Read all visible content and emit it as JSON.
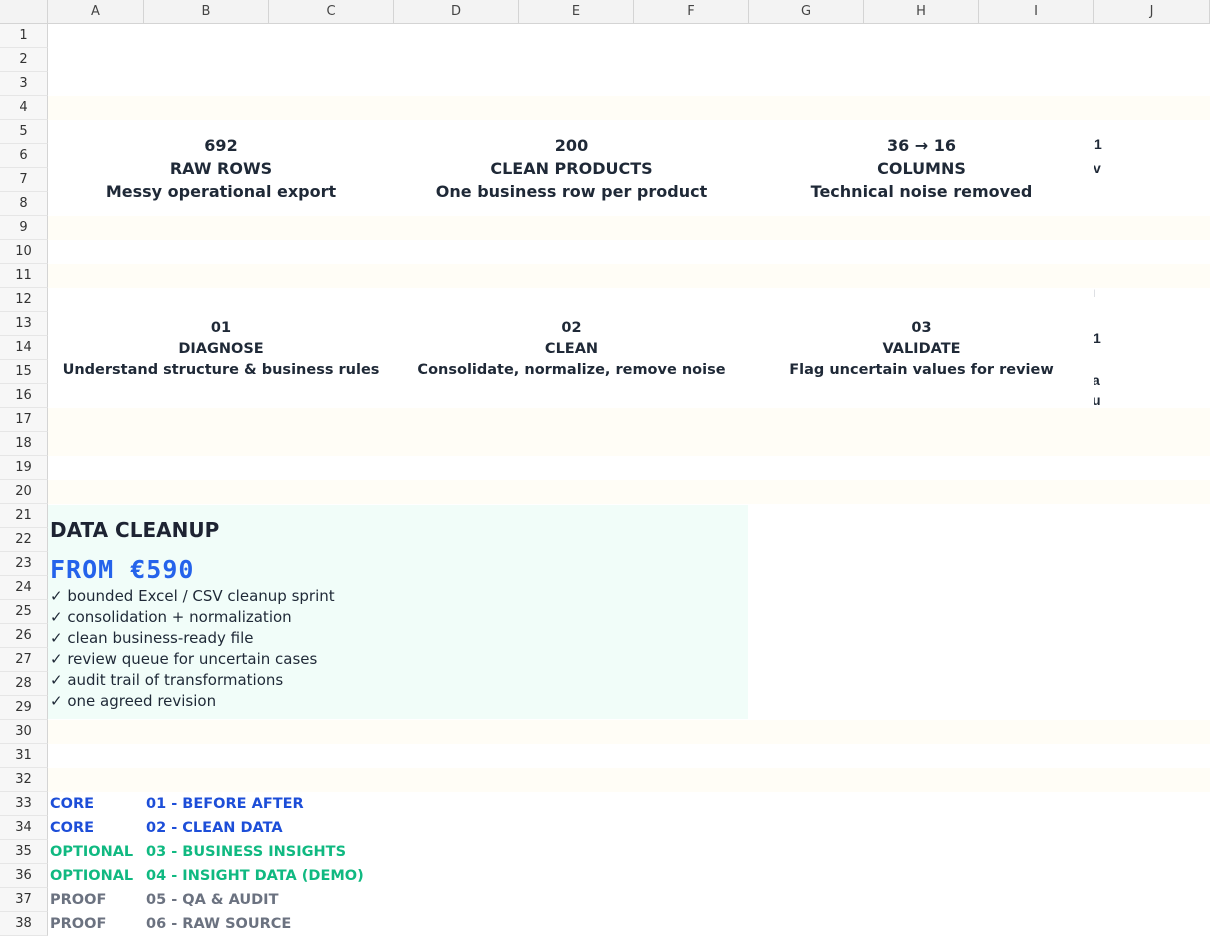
{
  "columns": [
    "A",
    "B",
    "C",
    "D",
    "E",
    "F",
    "G",
    "H",
    "I",
    "J"
  ],
  "rows": [
    "1",
    "2",
    "3",
    "4",
    "5",
    "6",
    "7",
    "8",
    "9",
    "10",
    "11",
    "12",
    "13",
    "14",
    "15",
    "16",
    "17",
    "18",
    "19",
    "20",
    "21",
    "22",
    "23",
    "24",
    "25",
    "26",
    "27",
    "28",
    "29",
    "30",
    "31",
    "32",
    "33",
    "34",
    "35",
    "36",
    "37",
    "38"
  ],
  "kpis": [
    {
      "value": "692",
      "label": "RAW ROWS",
      "caption": "Messy operational export"
    },
    {
      "value": "200",
      "label": "CLEAN PRODUCTS",
      "caption": "One business row per product"
    },
    {
      "value": "36 → 16",
      "label": "COLUMNS",
      "caption": "Technical noise removed"
    }
  ],
  "steps": [
    {
      "number": "01",
      "name": "DIAGNOSE",
      "desc": "Understand structure & business rules"
    },
    {
      "number": "02",
      "name": "CLEAN",
      "desc": "Consolidate, normalize, remove noise"
    },
    {
      "number": "03",
      "name": "VALIDATE",
      "desc": "Flag uncertain values for review"
    }
  ],
  "clipped": {
    "kpi_lines": [
      "1",
      "v"
    ],
    "step_lines": [
      "I",
      "1",
      "a",
      "u"
    ]
  },
  "offer": {
    "title": "DATA CLEANUP",
    "price": "FROM €590",
    "features": [
      "✓ bounded Excel / CSV cleanup sprint",
      "✓ consolidation + normalization",
      "✓ clean business-ready file",
      "✓ review queue for uncertain cases",
      "✓ audit trail of transformations",
      "✓ one agreed revision"
    ]
  },
  "nav": [
    {
      "tag": "CORE",
      "link": "01 - BEFORE AFTER"
    },
    {
      "tag": "CORE",
      "link": "02 - CLEAN DATA"
    },
    {
      "tag": "OPTIONAL",
      "link": "03 - BUSINESS INSIGHTS"
    },
    {
      "tag": "OPTIONAL",
      "link": "04 - INSIGHT DATA (DEMO)"
    },
    {
      "tag": "PROOF",
      "link": "05 - QA & AUDIT"
    },
    {
      "tag": "PROOF",
      "link": "06 - RAW SOURCE"
    }
  ],
  "colors": {
    "core": "#1d4ed8",
    "optional": "#10b981",
    "proof": "#6b7280",
    "price": "#2563eb",
    "band": "#fffdf6",
    "offer_bg": "#f1fdf9"
  }
}
